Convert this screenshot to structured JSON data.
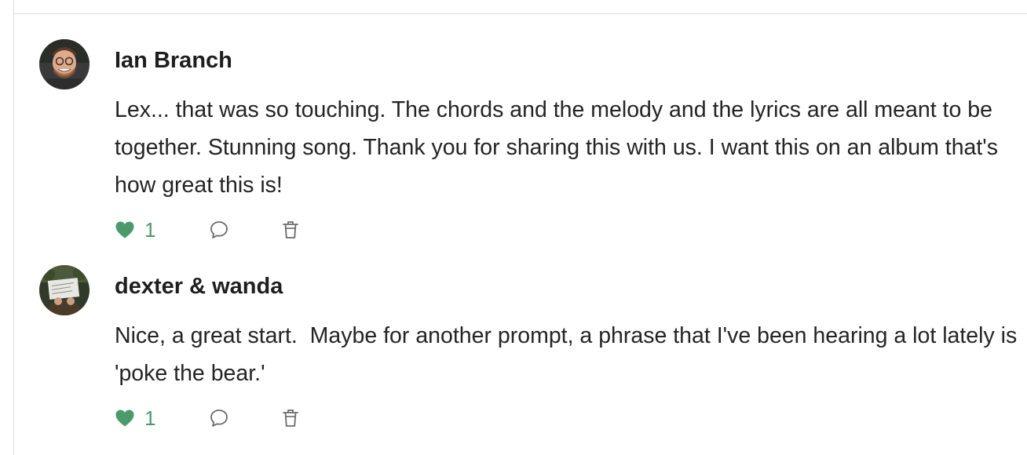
{
  "comments": [
    {
      "author": "Ian Branch",
      "avatar_icon": "avatar-ian-branch",
      "text": "Lex... that was so touching. The chords and the melody and the lyrics are all meant to be together. Stunning song. Thank you for sharing this with us. I want this on an album that's how great this is!",
      "likes": "1",
      "like_icon": "heart-icon",
      "reply_icon": "comment-bubble-icon",
      "delete_icon": "trash-icon"
    },
    {
      "author": "dexter & wanda",
      "avatar_icon": "avatar-dexter-wanda",
      "text": "Nice, a great start.  Maybe for another prompt, a phrase that I've been hearing a lot lately is 'poke the bear.'",
      "likes": "1",
      "like_icon": "heart-icon",
      "reply_icon": "comment-bubble-icon",
      "delete_icon": "trash-icon"
    }
  ],
  "colors": {
    "like_green": "#4a9a6e",
    "icon_gray": "#6b6b6b",
    "rule": "#dcdcdc",
    "author_text": "#1e1e1e",
    "body_text": "#242424"
  }
}
